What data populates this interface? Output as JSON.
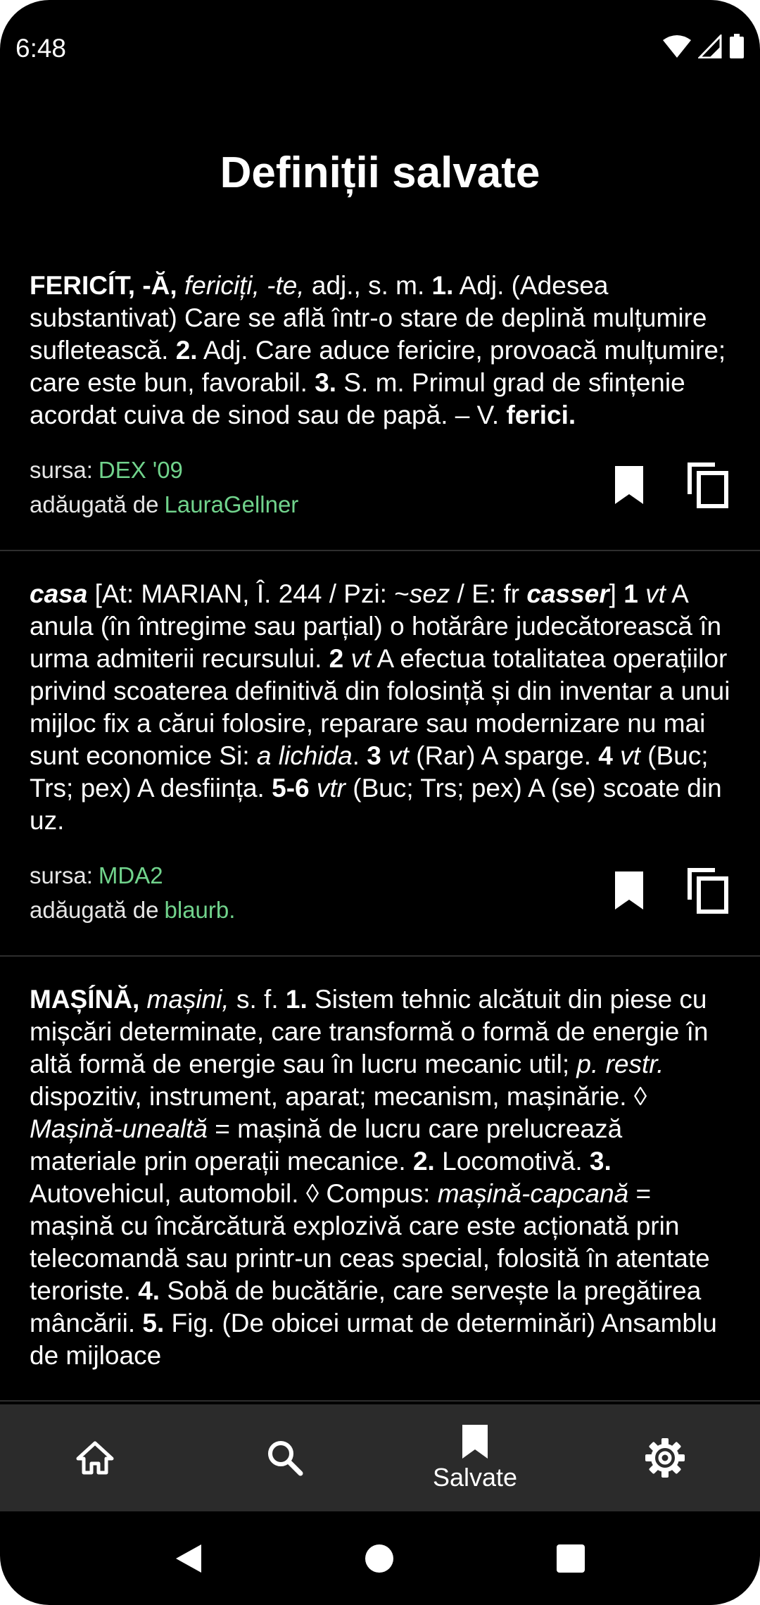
{
  "status_bar": {
    "time": "6:48"
  },
  "page": {
    "title": "Definiții salvate"
  },
  "entries": [
    {
      "segments": [
        {
          "t": "FERICÍT, -Ă,",
          "s": "b"
        },
        {
          "t": " ",
          "s": ""
        },
        {
          "t": "fericiți, -te,",
          "s": "i"
        },
        {
          "t": " adj., s. m. ",
          "s": ""
        },
        {
          "t": "1.",
          "s": "b"
        },
        {
          "t": " Adj. (Adesea substantivat) Care se află într-o stare de deplină mulțumire sufletească. ",
          "s": ""
        },
        {
          "t": "2.",
          "s": "b"
        },
        {
          "t": " Adj. Care aduce fericire, provoacă mulțumire; care este bun, favorabil. ",
          "s": ""
        },
        {
          "t": "3.",
          "s": "b"
        },
        {
          "t": " S. m. Primul grad de sfințenie acordat cuiva de sinod sau de papă. – V. ",
          "s": ""
        },
        {
          "t": "ferici.",
          "s": "b"
        }
      ],
      "source_label": "sursa:",
      "source": "DEX '09",
      "added_label": "adăugată de",
      "added_by": "LauraGellner"
    },
    {
      "segments": [
        {
          "t": "casa",
          "s": "bi"
        },
        {
          "t": " [At: MARIAN, Î. 244 / Pzi: ~",
          "s": ""
        },
        {
          "t": "sez",
          "s": "i"
        },
        {
          "t": " / E: fr ",
          "s": ""
        },
        {
          "t": "casser",
          "s": "bi"
        },
        {
          "t": "] ",
          "s": ""
        },
        {
          "t": "1",
          "s": "b"
        },
        {
          "t": " ",
          "s": ""
        },
        {
          "t": "vt",
          "s": "i"
        },
        {
          "t": " A anula (în întregime sau parțial) o hotărâre judecătorească în urma admiterii recursului. ",
          "s": ""
        },
        {
          "t": "2",
          "s": "b"
        },
        {
          "t": " ",
          "s": ""
        },
        {
          "t": "vt",
          "s": "i"
        },
        {
          "t": " A efectua totalitatea operațiilor privind scoaterea definitivă din folosință și din inventar a unui mijloc fix a cărui folosire, reparare sau modernizare nu mai sunt economice Si: ",
          "s": ""
        },
        {
          "t": "a lichida",
          "s": "i"
        },
        {
          "t": ". ",
          "s": ""
        },
        {
          "t": "3",
          "s": "b"
        },
        {
          "t": " ",
          "s": ""
        },
        {
          "t": "vt",
          "s": "i"
        },
        {
          "t": " (Rar) A sparge. ",
          "s": ""
        },
        {
          "t": "4",
          "s": "b"
        },
        {
          "t": " ",
          "s": ""
        },
        {
          "t": "vt",
          "s": "i"
        },
        {
          "t": " (Buc; Trs; pex) A desființa. ",
          "s": ""
        },
        {
          "t": "5-6",
          "s": "b"
        },
        {
          "t": " ",
          "s": ""
        },
        {
          "t": "vtr",
          "s": "i"
        },
        {
          "t": " (Buc; Trs; pex) A (se) scoate din uz.",
          "s": ""
        }
      ],
      "source_label": "sursa:",
      "source": "MDA2",
      "added_label": "adăugată de",
      "added_by": "blaurb."
    },
    {
      "segments": [
        {
          "t": "MAȘÍNĂ,",
          "s": "b"
        },
        {
          "t": " ",
          "s": ""
        },
        {
          "t": "mașini,",
          "s": "i"
        },
        {
          "t": " s. f. ",
          "s": ""
        },
        {
          "t": "1.",
          "s": "b"
        },
        {
          "t": " Sistem tehnic alcătuit din piese cu mișcări determinate, care transformă o formă de energie în altă formă de energie sau în lucru mecanic util; ",
          "s": ""
        },
        {
          "t": "p. restr.",
          "s": "i"
        },
        {
          "t": " dispozitiv, instrument, aparat; mecanism, mașinărie. ◊ ",
          "s": ""
        },
        {
          "t": "Mașină-unealtă",
          "s": "i"
        },
        {
          "t": " = mașină de lucru care prelucrează materiale prin operații mecanice. ",
          "s": ""
        },
        {
          "t": "2.",
          "s": "b"
        },
        {
          "t": " Locomotivă. ",
          "s": ""
        },
        {
          "t": "3.",
          "s": "b"
        },
        {
          "t": " Autovehicul, automobil. ◊ Compus: ",
          "s": ""
        },
        {
          "t": "mașină-capcană",
          "s": "i"
        },
        {
          "t": " = mașină cu încărcătură explozivă care este acționată prin telecomandă sau printr-un ceas special, folosită în atentate teroriste. ",
          "s": ""
        },
        {
          "t": "4.",
          "s": "b"
        },
        {
          "t": " Sobă de bucătărie, care servește la pregătirea mâncării. ",
          "s": ""
        },
        {
          "t": "5.",
          "s": "b"
        },
        {
          "t": " Fig. (De obicei urmat de determinări) Ansamblu de mijloace",
          "s": ""
        }
      ]
    }
  ],
  "bottom_nav": {
    "items": [
      {
        "icon": "home-icon",
        "label": ""
      },
      {
        "icon": "search-icon",
        "label": ""
      },
      {
        "icon": "bookmark-icon",
        "label": "Salvate"
      },
      {
        "icon": "gear-icon",
        "label": ""
      }
    ],
    "colors": {
      "background": "#2b2b2b",
      "link": "#71d38c"
    }
  },
  "system_nav": [
    "back-icon",
    "home-circle-icon",
    "recents-icon"
  ]
}
